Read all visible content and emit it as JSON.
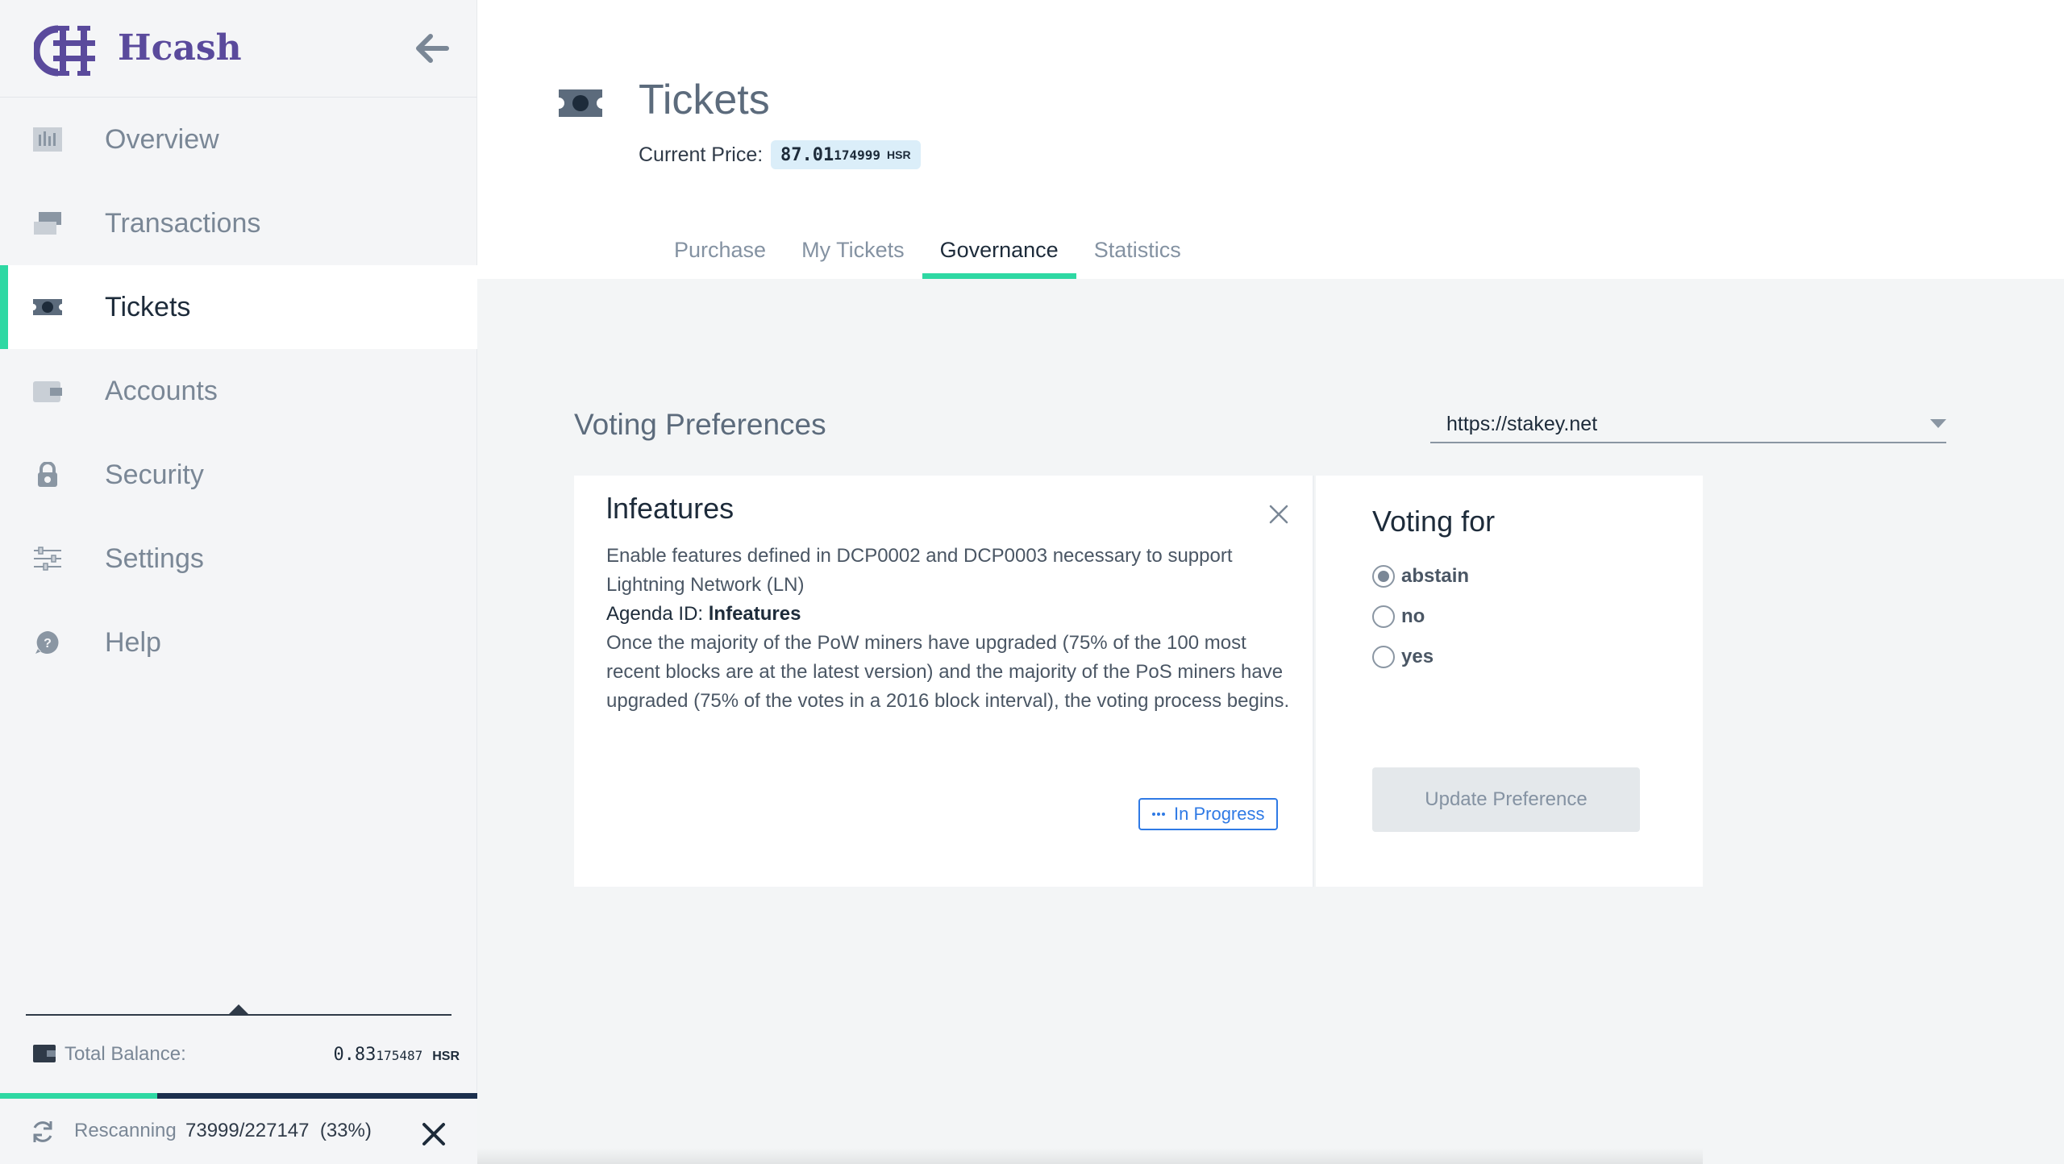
{
  "app": {
    "name": "Hcash",
    "accent_color": "#2ed8a3",
    "brand_color": "#5a4a9c"
  },
  "sidebar": {
    "collapse_icon": "arrow-left-icon",
    "items": [
      {
        "label": "Overview",
        "icon": "overview-icon",
        "active": false
      },
      {
        "label": "Transactions",
        "icon": "transactions-icon",
        "active": false
      },
      {
        "label": "Tickets",
        "icon": "ticket-icon",
        "active": true
      },
      {
        "label": "Accounts",
        "icon": "wallet-icon",
        "active": false
      },
      {
        "label": "Security",
        "icon": "lock-icon",
        "active": false
      },
      {
        "label": "Settings",
        "icon": "sliders-icon",
        "active": false
      },
      {
        "label": "Help",
        "icon": "help-icon",
        "active": false
      }
    ],
    "balance": {
      "label": "Total Balance:",
      "amount_major": "0.83",
      "amount_minor": "175487",
      "unit": "HSR"
    },
    "rescan": {
      "label": "Rescanning",
      "count": "73999/227147",
      "percent_text": "(33%)",
      "progress": 0.33
    }
  },
  "header": {
    "title": "Tickets",
    "price_label": "Current Price:",
    "price_major": "87.01",
    "price_minor": "174999",
    "price_unit": "HSR",
    "tabs": [
      {
        "label": "Purchase",
        "active": false
      },
      {
        "label": "My Tickets",
        "active": false
      },
      {
        "label": "Governance",
        "active": true
      },
      {
        "label": "Statistics",
        "active": false
      }
    ]
  },
  "main": {
    "section_title": "Voting Preferences",
    "vsp": {
      "selected": "https://stakey.net"
    },
    "agenda": {
      "name": "lnfeatures",
      "description": "Enable features defined in DCP0002 and DCP0003 necessary to support Lightning Network (LN)",
      "id_label": "Agenda ID:",
      "id_value": "lnfeatures",
      "details": "Once the majority of the PoW miners have upgraded (75% of the 100 most recent blocks are at the latest version) and the majority of the PoS miners have upgraded (75% of the votes in a 2016 block interval), the voting process begins.",
      "status": "In Progress",
      "status_color": "#2f7ae5"
    },
    "voting": {
      "title": "Voting for",
      "options": [
        {
          "label": "abstain",
          "checked": true
        },
        {
          "label": "no",
          "checked": false
        },
        {
          "label": "yes",
          "checked": false
        }
      ],
      "update_button": "Update Preference"
    }
  }
}
